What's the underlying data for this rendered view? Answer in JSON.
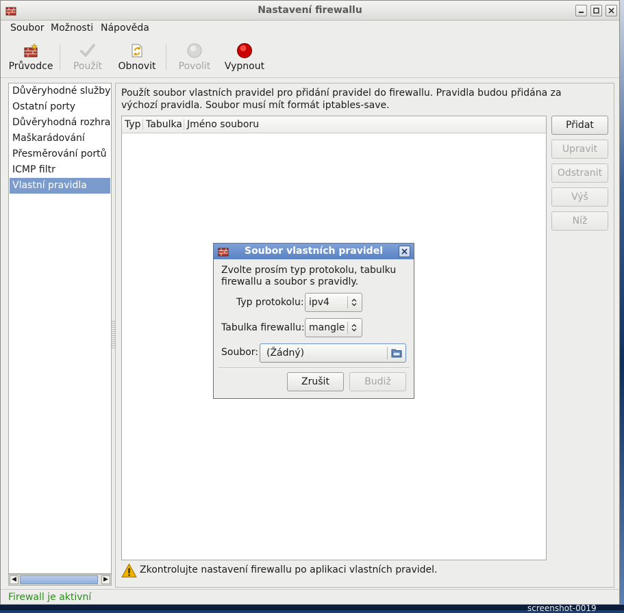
{
  "window": {
    "title": "Nastavení firewallu"
  },
  "menubar": {
    "items": [
      "Soubor",
      "Možnosti",
      "Nápověda"
    ]
  },
  "toolbar": {
    "buttons": [
      {
        "label": "Průvodce",
        "icon": "wizard-icon",
        "enabled": true
      },
      {
        "label": "Použít",
        "icon": "checkmark-icon",
        "enabled": false
      },
      {
        "label": "Obnovit",
        "icon": "reload-icon",
        "enabled": true
      },
      {
        "label": "Povolit",
        "icon": "gray-circle-icon",
        "enabled": false
      },
      {
        "label": "Vypnout",
        "icon": "red-circle-icon",
        "enabled": true
      }
    ]
  },
  "sidebar": {
    "items": [
      {
        "label": "Důvěryhodné služby",
        "selected": false
      },
      {
        "label": "Ostatní porty",
        "selected": false
      },
      {
        "label": "Důvěryhodná rozhraní",
        "selected": false
      },
      {
        "label": "Maškarádování",
        "selected": false
      },
      {
        "label": "Přesměrování portů",
        "selected": false
      },
      {
        "label": "ICMP filtr",
        "selected": false
      },
      {
        "label": "Vlastní pravidla",
        "selected": true
      }
    ]
  },
  "main": {
    "description": "Použít soubor vlastních pravidel pro přidání pravidel do firewallu. Pravidla budou přidána za výchozí pravidla. Soubor musí mít formát iptables-save.",
    "table": {
      "columns": [
        "Typ",
        "Tabulka",
        "Jméno souboru"
      ],
      "rows": []
    },
    "buttons": {
      "add": "Přidat",
      "edit": "Upravit",
      "remove": "Odstranit",
      "up": "Výš",
      "down": "Níž"
    },
    "warning": "Zkontrolujte nastavení firewallu po aplikaci vlastních pravidel."
  },
  "status": {
    "text": "Firewall je aktivní",
    "color": "#2e8b1e"
  },
  "dialog": {
    "title": "Soubor vlastních pravidel",
    "message": "Zvolte prosím typ protokolu, tabulku firewallu a soubor s pravidly.",
    "protocol_label": "Typ protokolu:",
    "protocol_value": "ipv4",
    "table_label": "Tabulka firewallu:",
    "table_value": "mangle",
    "file_label": "Soubor:",
    "file_value": "(Žádný)",
    "cancel": "Zrušit",
    "ok": "Budiž"
  },
  "desktop": {
    "label": "screenshot-0019"
  },
  "colors": {
    "selection": "#7b9bcc",
    "dialog_titlebar": "#5a83c4",
    "status_text": "#2e8b1e"
  }
}
